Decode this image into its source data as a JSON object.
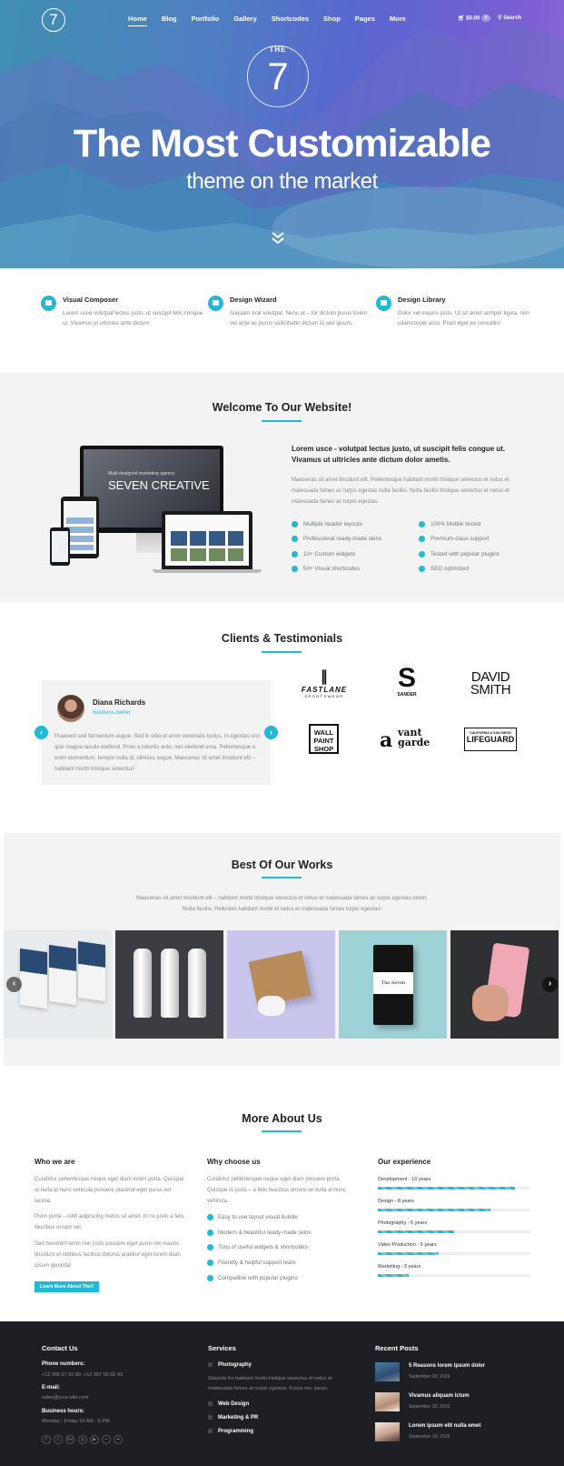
{
  "brand": {
    "logo_text": "7",
    "accent": "#22b8d8"
  },
  "nav": {
    "items": [
      "Home",
      "Blog",
      "Portfolio",
      "Gallery",
      "Shortcodes",
      "Shop",
      "Pages",
      "More"
    ],
    "active": "Home",
    "cart_total": "$0.00",
    "cart_count": "0",
    "search_label": "Search"
  },
  "hero": {
    "badge_top": "THE",
    "badge_num": "7",
    "title": "The Most Customizable",
    "subtitle": "theme on the market"
  },
  "features": [
    {
      "title": "Visual Composer",
      "text": "Lorem usce volutpat lectus justo, ut suscipit felis congue ut. Vivamus ut ultricies ante dictum.",
      "icon": "visual-composer-icon"
    },
    {
      "title": "Design Wizard",
      "text": "Aliquam erat volutpat. Nunc ut – for dictum purus lorem vel ante ac purus sollicitudin dictum id sed ipsum.",
      "icon": "design-wizard-icon"
    },
    {
      "title": "Design Library",
      "text": "Dolor vel mauris justo. Ut sit amet semper ligula, non ullamcorper arcu. Proin eget ex convallis!",
      "icon": "design-library-icon"
    }
  ],
  "welcome": {
    "title": "Welcome To Our Website!",
    "lead": "Lorem usce - volutpat lectus justo, ut suscipit felis congue ut. Vivamus ut ultricies ante dictum dolor ametis.",
    "text": "Maecenas sit amet tincidunt elit. Pellentesque habitant morbi tristique senectus et netus et malesuada fames ac turpis egestas nulla facilisi. Nulla facilisi tristique senectus et netus et malesuada fames ac turpis egestas.",
    "device_headline": "SEVEN CREATIVE",
    "device_small": "Multi-designed marketing agency",
    "list_left": [
      "Multiple header layouts",
      "Professional ready-made skins",
      "10+ Custom widgets",
      "50+ Visual shortcodes"
    ],
    "list_right": [
      "100% Mobile tested",
      "Premium-class support",
      "Tested with popular plugins",
      "SEO optimized"
    ]
  },
  "clients": {
    "title": "Clients & Testimonials",
    "testimonial": {
      "name": "Diana Richards",
      "position": "business owner",
      "text": "Praesent sed fermentum augue. Sed in odio et enim venenatis luctus. In egestas orci quis magna iaculis eleifend. Proin a lobortis ante, nec eleifend urna. Pellentesque a enim elementum, tempor nulla id, ultricies augue. Maecenas sit amet tincidunt elit – habitant morbi tristique senectus!"
    },
    "logos": {
      "fastlane": "FASTLANE",
      "fastlane_sub": "SPORTSWEAR",
      "sander_mark": "S",
      "sander": "SANDER",
      "david_smith_1": "DAVID",
      "david_smith_2": "SMITH",
      "wps": [
        "WALL",
        "PAINT",
        "SHOP"
      ],
      "vantgarde_a": "a",
      "vantgarde_1": "vant",
      "vantgarde_2": "garde",
      "lifeguard_top": "CALIFORNIA & SAN DIEGO",
      "lifeguard": "LIFEGUARD"
    }
  },
  "works": {
    "title": "Best Of Our Works",
    "text": "Maecenas sit amet tincidunt elit – habitant morbi tristique senectus et netus et malesuada fames ac turpis egestas lorem. Nulla facilisi. Pellentes habitant morbi et netus et malesuada fames turpis egestas!",
    "notebook_label": "The Seven"
  },
  "about": {
    "title": "More About Us",
    "who": {
      "heading": "Who we are",
      "p1": "Curabitur pellentesque neque eget diam lorem porta. Quisque ut nulla at nunc vehicula posuere placerat eget purus vel lacinia.",
      "p2": "Proin porta – nibh adipiscing metus sit amet. In nu justo a felis faucibus ornare vel.",
      "p3": "Sed hendrerit enim non justo posuere eget purus vel mauris tincidunt et nibhbus facilisis dolorus urabitur eget lorem diam ipsum glenrida!",
      "button": "Learn More About The7"
    },
    "why": {
      "heading": "Why choose us",
      "text": "Curabitur pellentesque neque eget diam posuere porta. Quisque ru justo – a felis faucibus ornare ve nulla at nunc vehicula.",
      "items": [
        "Easy to use layout visual builder",
        "Modern & beautiful ready-made skins",
        "Tons of useful widgets & shortcodes",
        "Friendly & helpful support team",
        "Compatible with popular plugins"
      ]
    },
    "experience": {
      "heading": "Our experience",
      "skills": [
        {
          "label": "Development - 10 years",
          "value": 0.9
        },
        {
          "label": "Design - 8 years",
          "value": 0.74
        },
        {
          "label": "Photography - 6 years",
          "value": 0.5
        },
        {
          "label": "Video Production - 5 years",
          "value": 0.4
        },
        {
          "label": "Marketing - 2 years",
          "value": 0.2
        }
      ]
    }
  },
  "footer": {
    "contact": {
      "heading": "Contact Us",
      "phone_label": "Phone numbers:",
      "phone": "+12 345 67 00 89, +12 987 00 65 43",
      "email_label": "E-mail:",
      "email": "sales@your-site.com",
      "hours_label": "Business hours:",
      "hours": "Monday - Friday 10 AM - 6 PM",
      "social": [
        "facebook-icon",
        "twitter-icon",
        "google-plus-icon",
        "dribbble-icon",
        "youtube-icon",
        "rss-icon",
        "flickr-icon"
      ],
      "social_glyphs": [
        "f",
        "t",
        "G+",
        "◎",
        "▶",
        "⌁",
        "••"
      ]
    },
    "services": {
      "heading": "Services",
      "item1": "Photography",
      "item1_text": "Glavrida for habitant morbi tristique senectus et netus et malesuada fames ac turpis egestas. Fusce nec ipsum.",
      "items": [
        "Web Design",
        "Marketing & PR",
        "Programming"
      ]
    },
    "posts": {
      "heading": "Recent Posts",
      "items": [
        {
          "title": "5 Reasons lorem ipsum dolor",
          "date": "September 20, 2016"
        },
        {
          "title": "Vivamus aliquam ictum",
          "date": "September 20, 2016"
        },
        {
          "title": "Lorem ipsum elit nulla emet",
          "date": "September 19, 2016"
        }
      ]
    }
  }
}
